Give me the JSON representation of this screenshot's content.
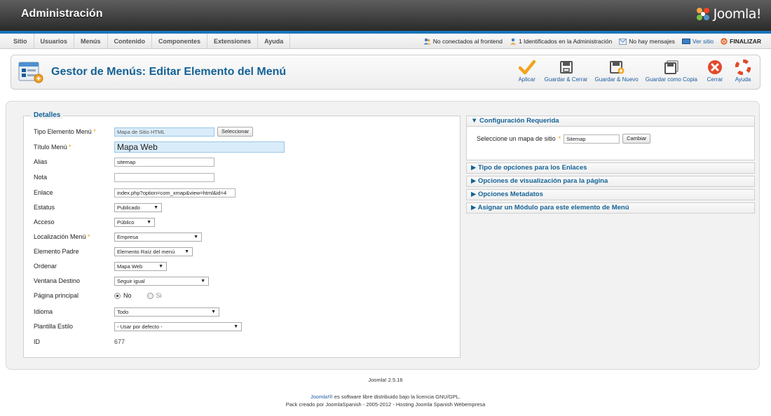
{
  "header": {
    "title": "Administración",
    "logo_text": "Joomla!"
  },
  "menubar": {
    "items": [
      "Sitio",
      "Usuarios",
      "Menús",
      "Contenido",
      "Componentes",
      "Extensiones",
      "Ayuda"
    ],
    "status": {
      "frontend": "No conectados al frontend",
      "admin": "1 Identificados en la Administración",
      "messages": "No hay mensajes",
      "view_site": "Ver sitio",
      "logout": "FINALIZAR"
    }
  },
  "toolbar": {
    "title": "Gestor de Menús: Editar Elemento del Menú",
    "buttons": {
      "apply": "Aplicar",
      "save_close": "Guardar & Cerrar",
      "save_new": "Guardar & Nuevo",
      "save_copy": "Guardar como Copia",
      "close": "Cerrar",
      "help": "Ayuda"
    }
  },
  "details": {
    "legend": "Detalles",
    "type_label": "Tipo Elemento Menú",
    "type_value": "Mapa de Sitio HTML",
    "select_button": "Seleccionar",
    "title_label": "Título Menú",
    "title_value": "Mapa Web",
    "alias_label": "Alias",
    "alias_value": "sitemap",
    "note_label": "Nota",
    "note_value": "",
    "link_label": "Enlace",
    "link_value": "index.php?option=com_xmap&view=html&id=4",
    "status_label": "Estatus",
    "status_value": "Publicado",
    "access_label": "Acceso",
    "access_value": "Público",
    "location_label": "Localización Menú",
    "location_value": "Empresa",
    "parent_label": "Elemento Padre",
    "parent_value": "Elemento Raíz del menú",
    "order_label": "Ordenar",
    "order_value": "Mapa Web",
    "target_label": "Ventana Destino",
    "target_value": "Seguir igual",
    "home_label": "Página principal",
    "home_no": "No",
    "home_yes": "Si",
    "language_label": "Idioma",
    "language_value": "Todo",
    "template_label": "Plantilla Estilo",
    "template_value": "- Usar por defecto -",
    "id_label": "ID",
    "id_value": "677",
    "required_mark": "*"
  },
  "right": {
    "required_config": "Configuración Requerida",
    "sitemap_label": "Seleccione un mapa de sitio",
    "sitemap_value": "Sitemap",
    "change_button": "Cambiar",
    "link_options": "Tipo de opciones para los Enlaces",
    "display_options": "Opciones de visualización para la página",
    "metadata_options": "Opciones Metadatos",
    "module_assign": "Asignar un Módulo para este elemento de Menú",
    "expanded_glyph": "▼",
    "collapsed_glyph": "▶"
  },
  "footer": {
    "version": "Joomla! 2.5.16",
    "license_link": "Joomla!®",
    "license_text": " es software libre distribuido bajo la licencia GNU/GPL.",
    "pack_text": "Pack creado por JoomlaSpanish - 2005-2012 - Hosting Joomla Spanish Webempresa"
  },
  "colors": {
    "accent": "#1b75bb",
    "title_blue": "#146295",
    "link_blue": "#1a5a9e",
    "required": "#e8a000"
  }
}
